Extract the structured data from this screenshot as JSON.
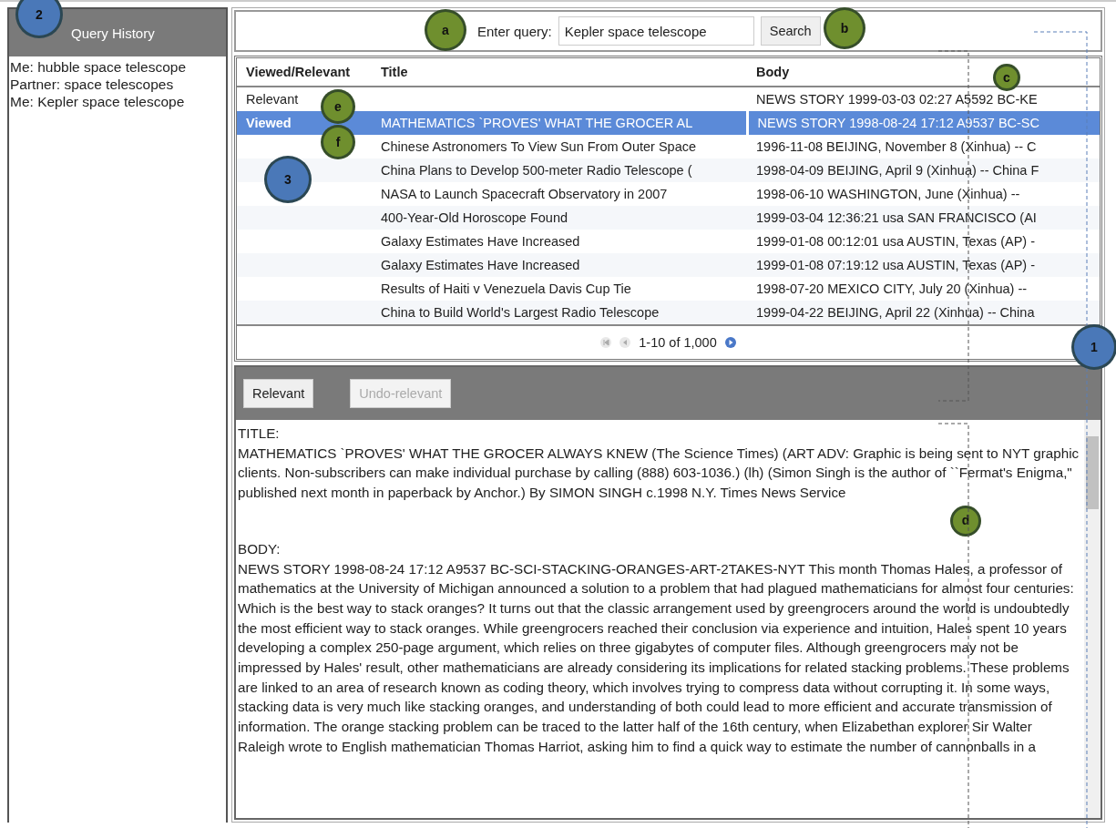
{
  "sidebar": {
    "title": "Query History",
    "items": [
      {
        "text": "Me: hubble space telescope"
      },
      {
        "text": "Partner: space telescopes"
      },
      {
        "text": "Me: Kepler space telescope"
      }
    ]
  },
  "search": {
    "label": "Enter query:",
    "value": "Kepler space telescope",
    "button": "Search"
  },
  "table": {
    "columns": [
      "Viewed/Relevant",
      "Title",
      "Body"
    ],
    "rows": [
      {
        "status": "Relevant",
        "title": "",
        "body": "NEWS STORY 1999-03-03 02:27 A5592 BC-KE",
        "selected": false
      },
      {
        "status": "Viewed",
        "title": "MATHEMATICS `PROVES' WHAT THE GROCER AL",
        "body": "NEWS STORY 1998-08-24 17:12 A9537 BC-SC",
        "selected": true
      },
      {
        "status": "",
        "title": "Chinese Astronomers To View Sun From Outer Space",
        "body": "1996-11-08 BEIJING, November 8 (Xinhua) -- C",
        "selected": false
      },
      {
        "status": "",
        "title": "China Plans to Develop 500-meter Radio Telescope (",
        "body": "1998-04-09 BEIJING, April 9 (Xinhua) -- China F",
        "selected": false
      },
      {
        "status": "",
        "title": "NASA to Launch Spacecraft Observatory in 2007",
        "body": "1998-06-10 WASHINGTON, June (Xinhua) --",
        "selected": false
      },
      {
        "status": "",
        "title": "400-Year-Old Horoscope Found",
        "body": "1999-03-04 12:36:21 usa SAN FRANCISCO (AI",
        "selected": false
      },
      {
        "status": "",
        "title": "Galaxy Estimates Have Increased",
        "body": "1999-01-08 00:12:01 usa AUSTIN, Texas (AP) -",
        "selected": false
      },
      {
        "status": "",
        "title": "Galaxy Estimates Have Increased",
        "body": "1999-01-08 07:19:12 usa AUSTIN, Texas (AP) -",
        "selected": false
      },
      {
        "status": "",
        "title": "Results of Haiti v Venezuela Davis Cup Tie",
        "body": "1998-07-20 MEXICO CITY, July 20 (Xinhua) --",
        "selected": false
      },
      {
        "status": "",
        "title": "China to Build World's Largest Radio Telescope",
        "body": "1999-04-22 BEIJING, April 22 (Xinhua) -- China",
        "selected": false
      }
    ],
    "pager": {
      "text": "1-10 of 1,000"
    }
  },
  "detail": {
    "buttons": [
      {
        "label": "Relevant",
        "disabled": false
      },
      {
        "label": "Undo-relevant",
        "disabled": true
      }
    ],
    "paragraphs": [
      "TITLE:",
      "MATHEMATICS `PROVES' WHAT THE GROCER ALWAYS KNEW (The Science Times) (ART ADV: Graphic is being sent to NYT graphic clients. Non-subscribers can make individual purchase by calling (888) 603-1036.) (lh) (Simon Singh is the author of ``Fermat's Enigma,\" published next month in paperback by Anchor.) By SIMON SINGH c.1998 N.Y. Times News Service",
      "BODY:",
      "NEWS STORY 1998-08-24 17:12 A9537 BC-SCI-STACKING-ORANGES-ART-2TAKES-NYT This month Thomas Hales, a professor of mathematics at the University of Michigan announced a solution to a problem that had plagued mathematicians for almost four centuries: Which is the best way to stack oranges? It turns out that the classic arrangement used by greengrocers around the world is undoubtedly the most efficient way to stack oranges. While greengrocers reached their conclusion via experience and intuition, Hales spent 10 years developing a complex 250-page argument, which relies on three gigabytes of computer files. Although greengrocers may not be impressed by Hales' result, other mathematicians are already considering its implications for related stacking problems. These problems are linked to an area of research known as coding theory, which involves trying to compress data without corrupting it. In some ways, stacking data is very much like stacking oranges, and understanding of both could lead to more efficient and accurate transmission of information. The orange stacking problem can be traced to the latter half of the 16th century, when Elizabethan explorer Sir Walter Raleigh wrote to English mathematician Thomas Harriot, asking him to find a quick way to estimate the number of cannonballs in a"
    ]
  },
  "annotations": [
    {
      "label": "2",
      "color": "#4a78b8"
    },
    {
      "label": "a",
      "color": "#6f8f2e"
    },
    {
      "label": "b",
      "color": "#6f8f2e"
    },
    {
      "label": "e",
      "color": "#6f8f2e"
    },
    {
      "label": "f",
      "color": "#6f8f2e"
    },
    {
      "label": "3",
      "color": "#4a78b8"
    },
    {
      "label": "c",
      "color": "#6f8f2e"
    },
    {
      "label": "1",
      "color": "#4a78b8"
    },
    {
      "label": "d",
      "color": "#6f8f2e"
    }
  ]
}
